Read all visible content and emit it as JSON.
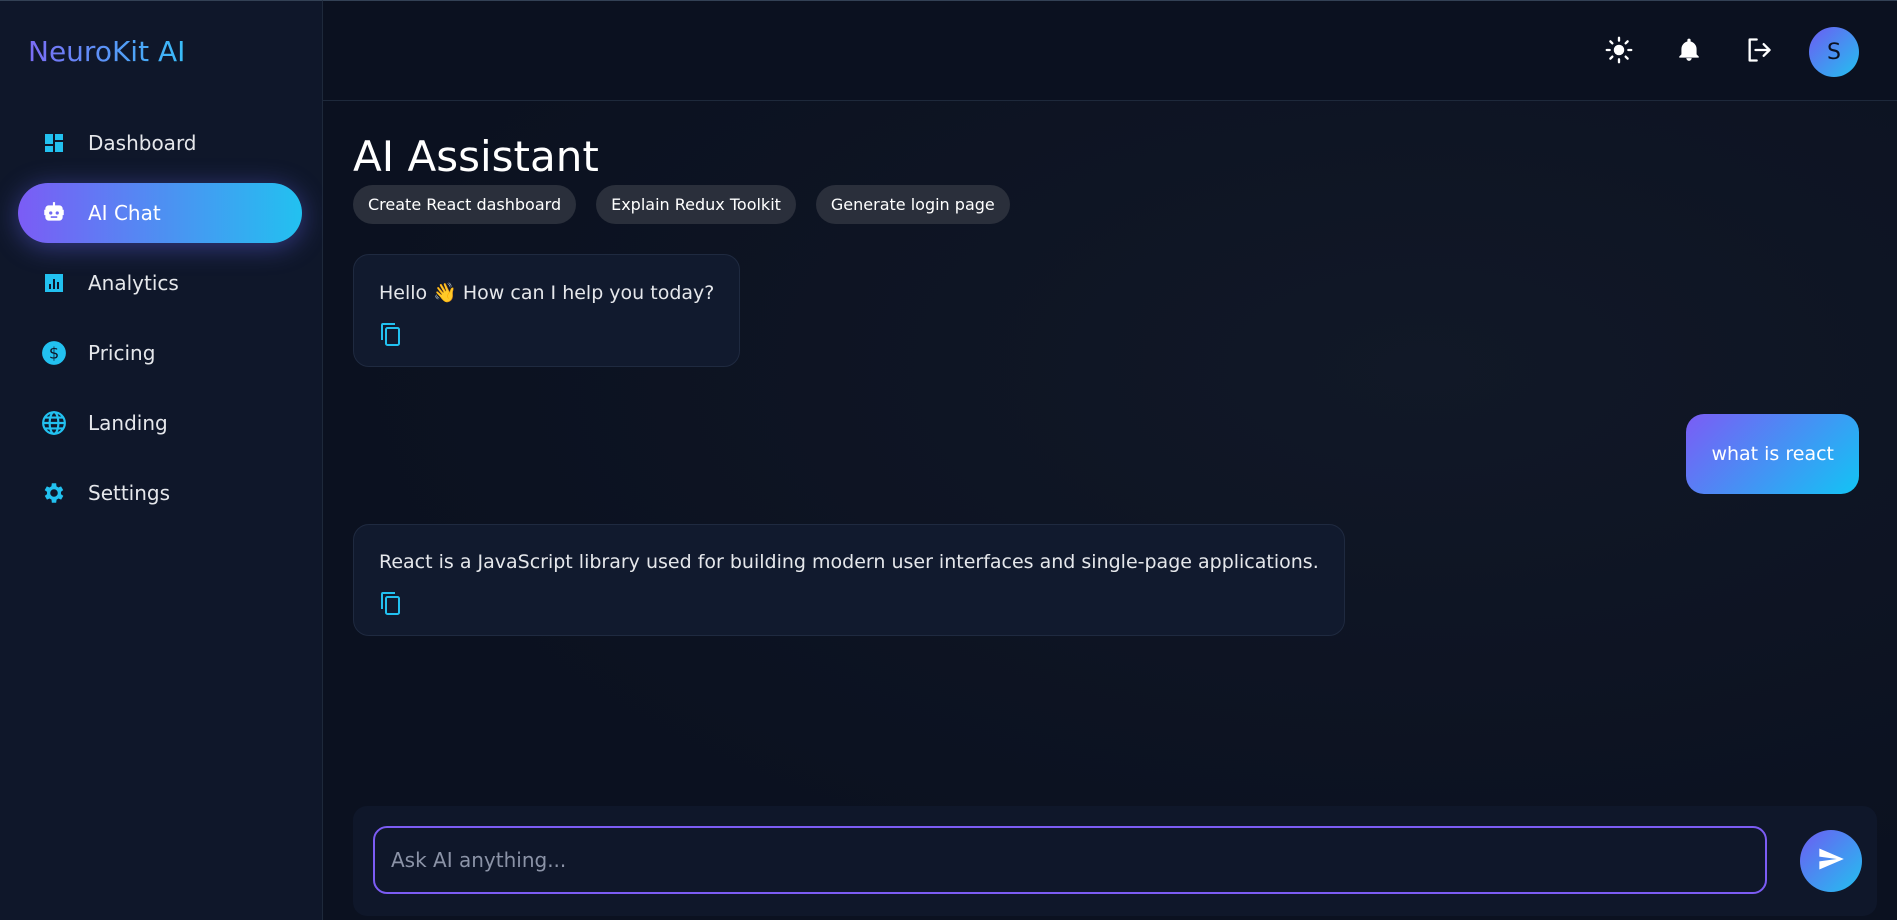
{
  "brand": {
    "name": "NeuroKit AI"
  },
  "sidebar": {
    "items": [
      {
        "label": "Dashboard",
        "icon": "dashboard-icon",
        "active": false
      },
      {
        "label": "AI Chat",
        "icon": "robot-icon",
        "active": true
      },
      {
        "label": "Analytics",
        "icon": "analytics-icon",
        "active": false
      },
      {
        "label": "Pricing",
        "icon": "dollar-icon",
        "active": false
      },
      {
        "label": "Landing",
        "icon": "globe-icon",
        "active": false
      },
      {
        "label": "Settings",
        "icon": "gear-icon",
        "active": false
      }
    ]
  },
  "topbar": {
    "icons": [
      "sun-icon",
      "bell-icon",
      "logout-icon"
    ],
    "avatar_initial": "S"
  },
  "main": {
    "title": "AI Assistant",
    "suggestions": [
      "Create React dashboard",
      "Explain Redux Toolkit",
      "Generate login page"
    ],
    "messages": [
      {
        "role": "ai",
        "text": "Hello 👋 How can I help you today?"
      },
      {
        "role": "user",
        "text": "what is react"
      },
      {
        "role": "ai",
        "text": "React is a JavaScript library used for building modern user interfaces and single-page applications."
      }
    ]
  },
  "composer": {
    "placeholder": "Ask AI anything...",
    "value": ""
  },
  "colors": {
    "accent_start": "#7b5cf5",
    "accent_end": "#12c4f4",
    "icon_cyan": "#22c1f0",
    "background": "#0b1120",
    "sidebar_bg": "#0f172a"
  }
}
